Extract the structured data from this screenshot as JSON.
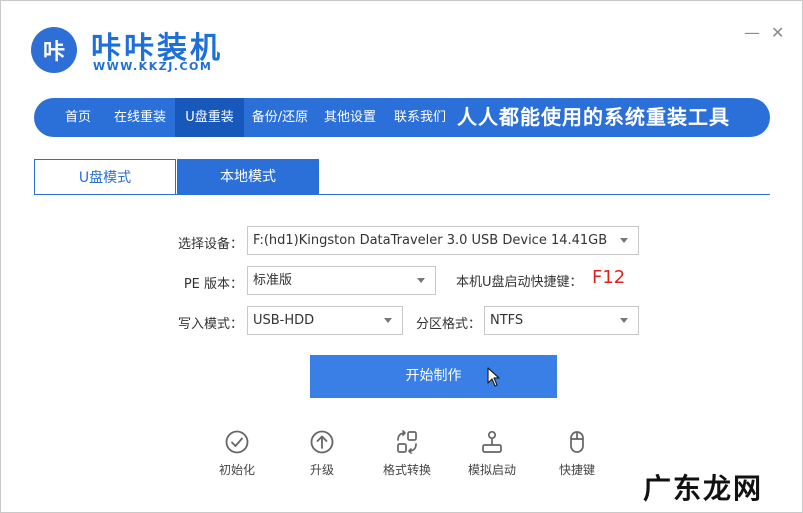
{
  "brand": {
    "logo_text": "咔",
    "name": "咔咔装机",
    "url": "WWW.KKZJ.COM"
  },
  "window_controls": {
    "minimize": "—",
    "close": "✕"
  },
  "nav": {
    "items": [
      {
        "label": "首页"
      },
      {
        "label": "在线重装"
      },
      {
        "label": "U盘重装"
      },
      {
        "label": "备份/还原"
      },
      {
        "label": "其他设置"
      },
      {
        "label": "联系我们"
      }
    ],
    "active_index": 2,
    "slogan": "人人都能使用的系统重装工具"
  },
  "tabs": [
    {
      "label": "U盘模式",
      "active": true
    },
    {
      "label": "本地模式",
      "active": false
    }
  ],
  "form": {
    "device_label": "选择设备：",
    "device_value": "F:(hd1)Kingston DataTraveler 3.0 USB Device 14.41GB",
    "pe_label": "PE 版本：",
    "pe_value": "标准版",
    "hotkey_label": "本机U盘启动快捷键：",
    "hotkey_value": "F12",
    "write_label": "写入模式：",
    "write_value": "USB-HDD",
    "partition_label": "分区格式：",
    "partition_value": "NTFS"
  },
  "start_button": "开始制作",
  "tools": [
    {
      "label": "初始化",
      "icon": "check-circle-icon"
    },
    {
      "label": "升级",
      "icon": "upload-circle-icon"
    },
    {
      "label": "格式转换",
      "icon": "convert-icon"
    },
    {
      "label": "模拟启动",
      "icon": "joystick-icon"
    },
    {
      "label": "快捷键",
      "icon": "mouse-icon"
    }
  ],
  "watermark": "广东龙网",
  "colors": {
    "primary": "#2b6fd8",
    "button": "#3a7fe6",
    "hotkey": "#e02020"
  }
}
